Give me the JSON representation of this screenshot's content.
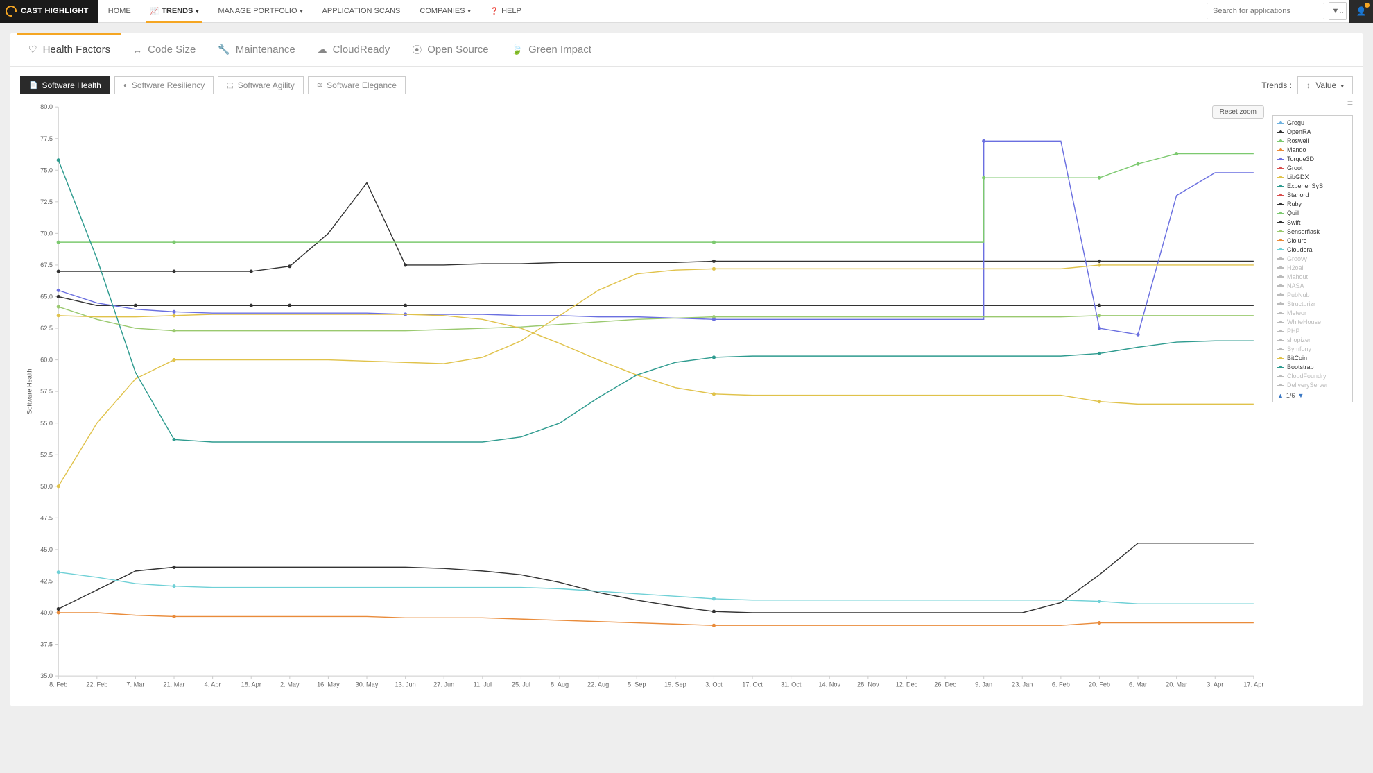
{
  "brand": "CAST HIGHLIGHT",
  "nav": {
    "items": [
      {
        "label": "HOME"
      },
      {
        "label": "TRENDS",
        "active": true,
        "caret": true,
        "icon": "chart"
      },
      {
        "label": "MANAGE PORTFOLIO",
        "caret": true
      },
      {
        "label": "APPLICATION SCANS"
      },
      {
        "label": "COMPANIES",
        "caret": true
      },
      {
        "label": "HELP",
        "icon": "help"
      }
    ],
    "search_placeholder": "Search for applications"
  },
  "subtabs": [
    {
      "label": "Health Factors",
      "icon": "stethoscope",
      "active": true
    },
    {
      "label": "Code Size",
      "icon": "arrows"
    },
    {
      "label": "Maintenance",
      "icon": "wrench"
    },
    {
      "label": "CloudReady",
      "icon": "cloud"
    },
    {
      "label": "Open Source",
      "icon": "osi"
    },
    {
      "label": "Green Impact",
      "icon": "leaf"
    }
  ],
  "pills": [
    {
      "label": "Software Health",
      "icon": "file",
      "active": true
    },
    {
      "label": "Software Resiliency",
      "icon": "contrast"
    },
    {
      "label": "Software Agility",
      "icon": "dash"
    },
    {
      "label": "Software Elegance",
      "icon": "layers"
    }
  ],
  "trends_label": "Trends :",
  "value_dd": "Value",
  "reset_zoom": "Reset zoom",
  "legend_pager": "1/6",
  "legend": [
    {
      "name": "Grogu",
      "color": "#6fb2e0",
      "disabled": false
    },
    {
      "name": "OpenRA",
      "color": "#333333",
      "disabled": false
    },
    {
      "name": "Roswell",
      "color": "#7cc96f",
      "disabled": false
    },
    {
      "name": "Mando",
      "color": "#e98b3a",
      "disabled": false
    },
    {
      "name": "Torque3D",
      "color": "#6a6fe0",
      "disabled": false
    },
    {
      "name": "Groot",
      "color": "#d94e4e",
      "disabled": false
    },
    {
      "name": "LibGDX",
      "color": "#e0c24a",
      "disabled": false
    },
    {
      "name": "ExperienSyS",
      "color": "#2e9b8f",
      "disabled": false
    },
    {
      "name": "Starlord",
      "color": "#d94e4e",
      "disabled": false
    },
    {
      "name": "Ruby",
      "color": "#333333",
      "disabled": false
    },
    {
      "name": "Quill",
      "color": "#7cc96f",
      "disabled": false
    },
    {
      "name": "Swift",
      "color": "#333333",
      "disabled": false
    },
    {
      "name": "Sensorflask",
      "color": "#9ac96f",
      "disabled": false
    },
    {
      "name": "Clojure",
      "color": "#e98b3a",
      "disabled": false
    },
    {
      "name": "Cloudera",
      "color": "#6fd0d6",
      "disabled": false
    },
    {
      "name": "Groovy",
      "color": "#bbb",
      "disabled": true
    },
    {
      "name": "H2oai",
      "color": "#bbb",
      "disabled": true
    },
    {
      "name": "Mahout",
      "color": "#bbb",
      "disabled": true
    },
    {
      "name": "NASA",
      "color": "#bbb",
      "disabled": true
    },
    {
      "name": "PubNub",
      "color": "#bbb",
      "disabled": true
    },
    {
      "name": "Structurizr",
      "color": "#bbb",
      "disabled": true
    },
    {
      "name": "Meteor",
      "color": "#bbb",
      "disabled": true
    },
    {
      "name": "WhiteHouse",
      "color": "#bbb",
      "disabled": true
    },
    {
      "name": "PHP",
      "color": "#bbb",
      "disabled": true
    },
    {
      "name": "shopizer",
      "color": "#bbb",
      "disabled": true
    },
    {
      "name": "Symfony",
      "color": "#bbb",
      "disabled": true
    },
    {
      "name": "BitCoin",
      "color": "#e0c24a",
      "disabled": false
    },
    {
      "name": "Bootstrap",
      "color": "#2e9b8f",
      "disabled": false
    },
    {
      "name": "CloudFoundry",
      "color": "#bbb",
      "disabled": true
    },
    {
      "name": "DeliveryServer",
      "color": "#bbb",
      "disabled": true
    }
  ],
  "chart_data": {
    "type": "line",
    "ylabel": "Software Health",
    "ylim": [
      35,
      80
    ],
    "yticks": [
      35.0,
      37.5,
      40.0,
      42.5,
      45.0,
      47.5,
      50.0,
      52.5,
      55.0,
      57.5,
      60.0,
      62.5,
      65.0,
      67.5,
      70.0,
      72.5,
      75.0,
      77.5,
      80.0
    ],
    "x": [
      "8. Feb",
      "22. Feb",
      "7. Mar",
      "21. Mar",
      "4. Apr",
      "18. Apr",
      "2. May",
      "16. May",
      "30. May",
      "13. Jun",
      "27. Jun",
      "11. Jul",
      "25. Jul",
      "8. Aug",
      "22. Aug",
      "5. Sep",
      "19. Sep",
      "3. Oct",
      "17. Oct",
      "31. Oct",
      "14. Nov",
      "28. Nov",
      "12. Dec",
      "26. Dec",
      "9. Jan",
      "23. Jan",
      "6. Feb",
      "20. Feb",
      "6. Mar",
      "20. Mar",
      "3. Apr",
      "17. Apr"
    ],
    "series": [
      {
        "name": "Swift",
        "color": "#333333",
        "values": [
          67.0,
          67.0,
          67.0,
          67.0,
          67.0,
          67.0,
          67.4,
          70.0,
          74.0,
          67.5,
          67.5,
          67.6,
          67.6,
          67.7,
          67.7,
          67.7,
          67.7,
          67.8,
          67.8,
          67.8,
          67.8,
          67.8,
          67.8,
          67.8,
          67.8,
          67.8,
          67.8,
          67.8,
          67.8,
          67.8,
          67.8,
          67.8
        ],
        "markers": [
          0,
          3,
          5,
          6,
          9,
          17,
          27
        ]
      },
      {
        "name": "Ruby",
        "color": "#333333",
        "values": [
          65.0,
          64.3,
          64.3,
          64.3,
          64.3,
          64.3,
          64.3,
          64.3,
          64.3,
          64.3,
          64.3,
          64.3,
          64.3,
          64.3,
          64.3,
          64.3,
          64.3,
          64.3,
          64.3,
          64.3,
          64.3,
          64.3,
          64.3,
          64.3,
          64.3,
          64.3,
          64.3,
          64.3,
          64.3,
          64.3,
          64.3,
          64.3
        ],
        "markers": [
          0,
          2,
          5,
          6,
          9,
          27
        ]
      },
      {
        "name": "OpenRA",
        "color": "#333333",
        "values": [
          40.3,
          41.8,
          43.3,
          43.6,
          43.6,
          43.6,
          43.6,
          43.6,
          43.6,
          43.6,
          43.5,
          43.3,
          43.0,
          42.4,
          41.6,
          41.0,
          40.5,
          40.1,
          40.0,
          40.0,
          40.0,
          40.0,
          40.0,
          40.0,
          40.0,
          40.0,
          40.8,
          43.0,
          45.5,
          45.5,
          45.5,
          45.5
        ],
        "markers": [
          0,
          3,
          17
        ]
      },
      {
        "name": "Torque3D",
        "color": "#6a6fe0",
        "values": [
          65.5,
          64.5,
          64.0,
          63.8,
          63.7,
          63.7,
          63.7,
          63.7,
          63.7,
          63.6,
          63.6,
          63.6,
          63.5,
          63.5,
          63.4,
          63.4,
          63.3,
          63.2,
          63.2,
          63.2,
          63.2,
          63.2,
          63.2,
          63.2,
          77.3,
          77.3,
          77.3,
          62.5,
          62.0,
          73.0,
          74.8,
          74.8
        ],
        "markers": [
          0,
          3,
          9,
          17,
          24,
          27,
          28
        ],
        "step": [
          24
        ]
      },
      {
        "name": "Roswell",
        "color": "#7cc96f",
        "values": [
          69.3,
          69.3,
          69.3,
          69.3,
          69.3,
          69.3,
          69.3,
          69.3,
          69.3,
          69.3,
          69.3,
          69.3,
          69.3,
          69.3,
          69.3,
          69.3,
          69.3,
          69.3,
          69.3,
          69.3,
          69.3,
          69.3,
          69.3,
          69.3,
          74.4,
          74.4,
          74.4,
          74.4,
          75.5,
          76.3,
          76.3,
          76.3
        ],
        "markers": [
          0,
          3,
          17,
          24,
          27,
          28,
          29
        ],
        "step": [
          24
        ]
      },
      {
        "name": "Sensorflask",
        "color": "#9ac96f",
        "values": [
          64.2,
          63.2,
          62.5,
          62.3,
          62.3,
          62.3,
          62.3,
          62.3,
          62.3,
          62.3,
          62.4,
          62.5,
          62.6,
          62.8,
          63.0,
          63.2,
          63.3,
          63.4,
          63.4,
          63.4,
          63.4,
          63.4,
          63.4,
          63.4,
          63.4,
          63.4,
          63.4,
          63.5,
          63.5,
          63.5,
          63.5,
          63.5
        ],
        "markers": [
          0,
          3,
          17,
          27
        ]
      },
      {
        "name": "LibGDX",
        "color": "#e0c24a",
        "values": [
          50.0,
          55.0,
          58.5,
          60.0,
          60.0,
          60.0,
          60.0,
          60.0,
          59.9,
          59.8,
          59.7,
          60.2,
          61.5,
          63.5,
          65.5,
          66.8,
          67.1,
          67.2,
          67.2,
          67.2,
          67.2,
          67.2,
          67.2,
          67.2,
          67.2,
          67.2,
          67.2,
          67.5,
          67.5,
          67.5,
          67.5,
          67.5
        ],
        "markers": [
          0,
          3,
          17,
          27
        ]
      },
      {
        "name": "BitCoin",
        "color": "#e0c24a",
        "values": [
          63.5,
          63.4,
          63.4,
          63.5,
          63.6,
          63.6,
          63.6,
          63.6,
          63.6,
          63.6,
          63.5,
          63.2,
          62.5,
          61.3,
          60.0,
          58.8,
          57.8,
          57.3,
          57.2,
          57.2,
          57.2,
          57.2,
          57.2,
          57.2,
          57.2,
          57.2,
          57.2,
          56.7,
          56.5,
          56.5,
          56.5,
          56.5
        ],
        "markers": [
          0,
          3,
          17,
          27
        ]
      },
      {
        "name": "Bootstrap",
        "color": "#2e9b8f",
        "values": [
          75.8,
          68.0,
          59.0,
          53.7,
          53.5,
          53.5,
          53.5,
          53.5,
          53.5,
          53.5,
          53.5,
          53.5,
          53.9,
          55.0,
          57.0,
          58.8,
          59.8,
          60.2,
          60.3,
          60.3,
          60.3,
          60.3,
          60.3,
          60.3,
          60.3,
          60.3,
          60.3,
          60.5,
          61.0,
          61.4,
          61.5,
          61.5
        ],
        "markers": [
          0,
          3,
          17,
          27
        ]
      },
      {
        "name": "Cloudera",
        "color": "#6fd0d6",
        "values": [
          43.2,
          42.8,
          42.3,
          42.1,
          42.0,
          42.0,
          42.0,
          42.0,
          42.0,
          42.0,
          42.0,
          42.0,
          42.0,
          41.9,
          41.7,
          41.5,
          41.3,
          41.1,
          41.0,
          41.0,
          41.0,
          41.0,
          41.0,
          41.0,
          41.0,
          41.0,
          41.0,
          40.9,
          40.7,
          40.7,
          40.7,
          40.7
        ],
        "markers": [
          0,
          3,
          17,
          27
        ]
      },
      {
        "name": "Clojure",
        "color": "#e98b3a",
        "values": [
          40.0,
          40.0,
          39.8,
          39.7,
          39.7,
          39.7,
          39.7,
          39.7,
          39.7,
          39.6,
          39.6,
          39.6,
          39.5,
          39.4,
          39.3,
          39.2,
          39.1,
          39.0,
          39.0,
          39.0,
          39.0,
          39.0,
          39.0,
          39.0,
          39.0,
          39.0,
          39.0,
          39.2,
          39.2,
          39.2,
          39.2,
          39.2
        ],
        "markers": [
          0,
          3,
          17,
          27
        ]
      }
    ]
  }
}
